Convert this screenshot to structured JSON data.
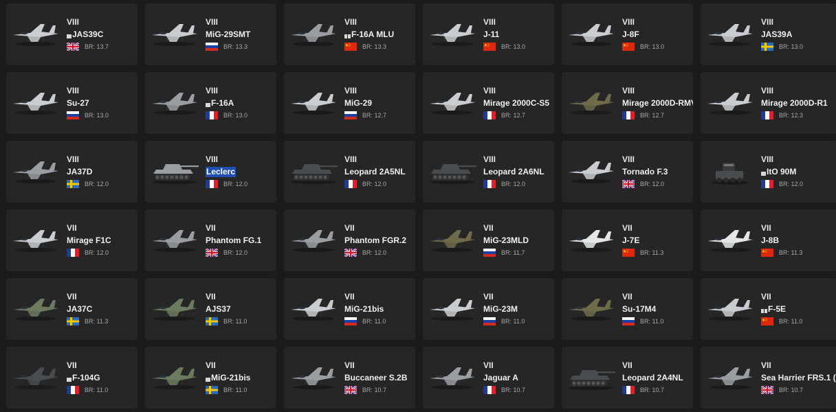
{
  "vehicles": [
    {
      "rank": "VIII",
      "name": "JAS39C",
      "prefix": "single",
      "country": "uk",
      "br": "BR: 13.7",
      "kind": "jet",
      "tone": "light"
    },
    {
      "rank": "VIII",
      "name": "MiG-29SMT",
      "prefix": "none",
      "country": "russia",
      "br": "BR: 13.3",
      "kind": "jet",
      "tone": "light"
    },
    {
      "rank": "VIII",
      "name": "F-16A MLU",
      "prefix": "double",
      "country": "china",
      "br": "BR: 13.3",
      "kind": "jet",
      "tone": "grey"
    },
    {
      "rank": "VIII",
      "name": "J-11",
      "prefix": "none",
      "country": "china",
      "br": "BR: 13.0",
      "kind": "jet",
      "tone": "light"
    },
    {
      "rank": "VIII",
      "name": "J-8F",
      "prefix": "none",
      "country": "china",
      "br": "BR: 13.0",
      "kind": "jet",
      "tone": "light"
    },
    {
      "rank": "VIII",
      "name": "JAS39A",
      "prefix": "none",
      "country": "sweden",
      "br": "BR: 13.0",
      "kind": "jet",
      "tone": "light"
    },
    {
      "rank": "VIII",
      "name": "Su-27",
      "prefix": "none",
      "country": "russia",
      "br": "BR: 13.0",
      "kind": "jet",
      "tone": "light"
    },
    {
      "rank": "VIII",
      "name": "F-16A",
      "prefix": "single",
      "country": "france",
      "br": "BR: 13.0",
      "kind": "jet",
      "tone": "grey"
    },
    {
      "rank": "VIII",
      "name": "MiG-29",
      "prefix": "none",
      "country": "russia",
      "br": "BR: 12.7",
      "kind": "jet",
      "tone": "light"
    },
    {
      "rank": "VIII",
      "name": "Mirage 2000C-S5",
      "prefix": "none",
      "country": "france",
      "br": "BR: 12.7",
      "kind": "jet",
      "tone": "light"
    },
    {
      "rank": "VIII",
      "name": "Mirage 2000D-RMV",
      "prefix": "none",
      "country": "france",
      "br": "BR: 12.7",
      "kind": "jet",
      "tone": "camo"
    },
    {
      "rank": "VIII",
      "name": "Mirage 2000D-R1",
      "prefix": "none",
      "country": "france",
      "br": "BR: 12.3",
      "kind": "jet",
      "tone": "light"
    },
    {
      "rank": "VIII",
      "name": "JA37D",
      "prefix": "none",
      "country": "sweden",
      "br": "BR: 12.0",
      "kind": "jet",
      "tone": "grey"
    },
    {
      "rank": "VIII",
      "name": "Leclerc",
      "prefix": "none",
      "highlight": true,
      "country": "france",
      "br": "BR: 12.0",
      "kind": "tank",
      "tone": "grey"
    },
    {
      "rank": "VIII",
      "name": "Leopard 2A5NL",
      "prefix": "none",
      "country": "france",
      "br": "BR: 12.0",
      "kind": "tank",
      "tone": "dark"
    },
    {
      "rank": "VIII",
      "name": "Leopard 2A6NL",
      "prefix": "none",
      "country": "france",
      "br": "BR: 12.0",
      "kind": "tank",
      "tone": "dark"
    },
    {
      "rank": "VIII",
      "name": "Tornado F.3",
      "prefix": "none",
      "country": "uk",
      "br": "BR: 12.0",
      "kind": "jet",
      "tone": "light"
    },
    {
      "rank": "VIII",
      "name": "ItO 90M",
      "prefix": "single",
      "country": "france",
      "br": "BR: 12.0",
      "kind": "launcher",
      "tone": "dark"
    },
    {
      "rank": "VII",
      "name": "Mirage F1C",
      "prefix": "none",
      "country": "france",
      "br": "BR: 12.0",
      "kind": "jet",
      "tone": "light"
    },
    {
      "rank": "VII",
      "name": "Phantom FG.1",
      "prefix": "none",
      "country": "uk",
      "br": "BR: 12.0",
      "kind": "jet",
      "tone": "grey"
    },
    {
      "rank": "VII",
      "name": "Phantom FGR.2",
      "prefix": "none",
      "country": "uk",
      "br": "BR: 12.0",
      "kind": "jet",
      "tone": "grey"
    },
    {
      "rank": "VII",
      "name": "MiG-23MLD",
      "prefix": "none",
      "country": "russia",
      "br": "BR: 11.7",
      "kind": "jet",
      "tone": "camo"
    },
    {
      "rank": "VII",
      "name": "J-7E",
      "prefix": "none",
      "country": "china",
      "br": "BR: 11.3",
      "kind": "jet",
      "tone": "white"
    },
    {
      "rank": "VII",
      "name": "J-8B",
      "prefix": "none",
      "country": "china",
      "br": "BR: 11.3",
      "kind": "jet",
      "tone": "white"
    },
    {
      "rank": "VII",
      "name": "JA37C",
      "prefix": "none",
      "country": "sweden",
      "br": "BR: 11.3",
      "kind": "jet",
      "tone": "green"
    },
    {
      "rank": "VII",
      "name": "AJS37",
      "prefix": "none",
      "country": "sweden",
      "br": "BR: 11.0",
      "kind": "jet",
      "tone": "green"
    },
    {
      "rank": "VII",
      "name": "MiG-21bis",
      "prefix": "none",
      "country": "russia",
      "br": "BR: 11.0",
      "kind": "jet",
      "tone": "light"
    },
    {
      "rank": "VII",
      "name": "MiG-23M",
      "prefix": "none",
      "country": "russia",
      "br": "BR: 11.0",
      "kind": "jet",
      "tone": "light"
    },
    {
      "rank": "VII",
      "name": "Su-17M4",
      "prefix": "none",
      "country": "russia",
      "br": "BR: 11.0",
      "kind": "jet",
      "tone": "camo"
    },
    {
      "rank": "VII",
      "name": "F-5E",
      "prefix": "double",
      "country": "china",
      "br": "BR: 11.0",
      "kind": "jet",
      "tone": "light"
    },
    {
      "rank": "VII",
      "name": "F-104G",
      "prefix": "single",
      "country": "france",
      "br": "BR: 11.0",
      "kind": "jet",
      "tone": "dark"
    },
    {
      "rank": "VII",
      "name": "MiG-21bis",
      "prefix": "single",
      "country": "sweden",
      "br": "BR: 11.0",
      "kind": "jet",
      "tone": "green"
    },
    {
      "rank": "VII",
      "name": "Buccaneer S.2B",
      "prefix": "none",
      "country": "uk",
      "br": "BR: 10.7",
      "kind": "jet",
      "tone": "grey"
    },
    {
      "rank": "VII",
      "name": "Jaguar A",
      "prefix": "none",
      "country": "france",
      "br": "BR: 10.7",
      "kind": "jet",
      "tone": "grey"
    },
    {
      "rank": "VII",
      "name": "Leopard 2A4NL",
      "prefix": "none",
      "country": "france",
      "br": "BR: 10.7",
      "kind": "tank",
      "tone": "dark"
    },
    {
      "rank": "VII",
      "name": "Sea Harrier FRS.1 (",
      "prefix": "none",
      "country": "uk",
      "br": "BR: 10.7",
      "kind": "jet",
      "tone": "grey"
    }
  ],
  "palette": {
    "light": "#c9ccd0",
    "grey": "#9a9ea3",
    "white": "#e4e6e8",
    "dark": "#4a4d50",
    "camo": "#6f6a4a",
    "green": "#6c7a5e"
  }
}
